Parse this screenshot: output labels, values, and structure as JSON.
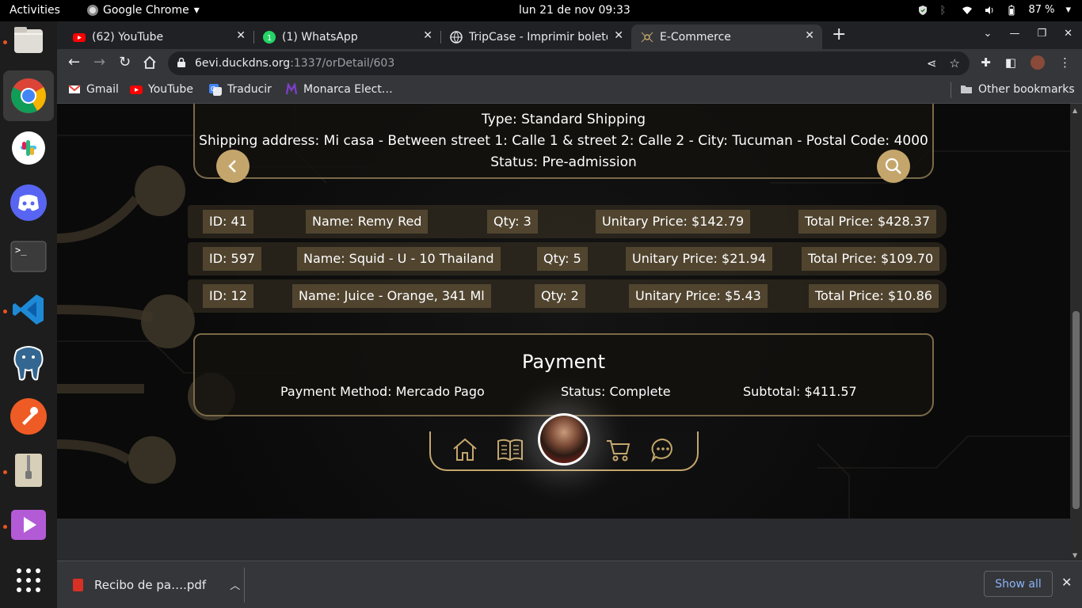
{
  "topbar": {
    "activities": "Activities",
    "app_name": "Google Chrome",
    "clock": "lun 21 de nov  09:33",
    "battery": "87 %"
  },
  "tabs": [
    {
      "title": "(62) YouTube",
      "icon": "youtube-icon",
      "color": "#ff0000"
    },
    {
      "title": "(1) WhatsApp",
      "icon": "whatsapp-icon",
      "color": "#25d366"
    },
    {
      "title": "TripCase - Imprimir boleto",
      "icon": "globe-icon",
      "color": "#9aa0a6"
    },
    {
      "title": "E-Commerce",
      "icon": "circuit-icon",
      "color": "#c4a66c"
    }
  ],
  "address": {
    "host": "6evi.duckdns.org",
    "path": ":1337/orDetail/603"
  },
  "bookmarks": [
    {
      "label": "Gmail",
      "icon": "gmail-icon",
      "color": "#ea4335"
    },
    {
      "label": "YouTube",
      "icon": "youtube-icon",
      "color": "#ff0000"
    },
    {
      "label": "Traducir",
      "icon": "translate-icon",
      "color": "#4285f4"
    },
    {
      "label": "Monarca Elect…",
      "icon": "monarca-icon",
      "color": "#5b2d91"
    }
  ],
  "other_bookmarks": "Other bookmarks",
  "shipping": {
    "type": "Type: Standard Shipping",
    "address": "Shipping address: Mi casa - Between street 1: Calle 1 & street 2: Calle 2 - City: Tucuman - Postal Code: 4000",
    "status": "Status: Pre-admission"
  },
  "items": [
    {
      "id": "ID: 41",
      "name": "Name: Remy Red",
      "qty": "Qty: 3",
      "unit": "Unitary Price: $142.79",
      "total": "Total Price: $428.37"
    },
    {
      "id": "ID: 597",
      "name": "Name: Squid - U - 10 Thailand",
      "qty": "Qty: 5",
      "unit": "Unitary Price: $21.94",
      "total": "Total Price: $109.70"
    },
    {
      "id": "ID: 12",
      "name": "Name: Juice - Orange, 341 Ml",
      "qty": "Qty: 2",
      "unit": "Unitary Price: $5.43",
      "total": "Total Price: $10.86"
    }
  ],
  "payment": {
    "title": "Payment",
    "method": "Payment Method: Mercado Pago",
    "status": "Status: Complete",
    "subtotal": "Subtotal: $411.57"
  },
  "download": {
    "file": "Recibo de pa….pdf",
    "show_all": "Show all"
  },
  "colors": {
    "gold": "#c4a66c",
    "card_border": "#7a6a48",
    "chip": "#5f5037"
  }
}
